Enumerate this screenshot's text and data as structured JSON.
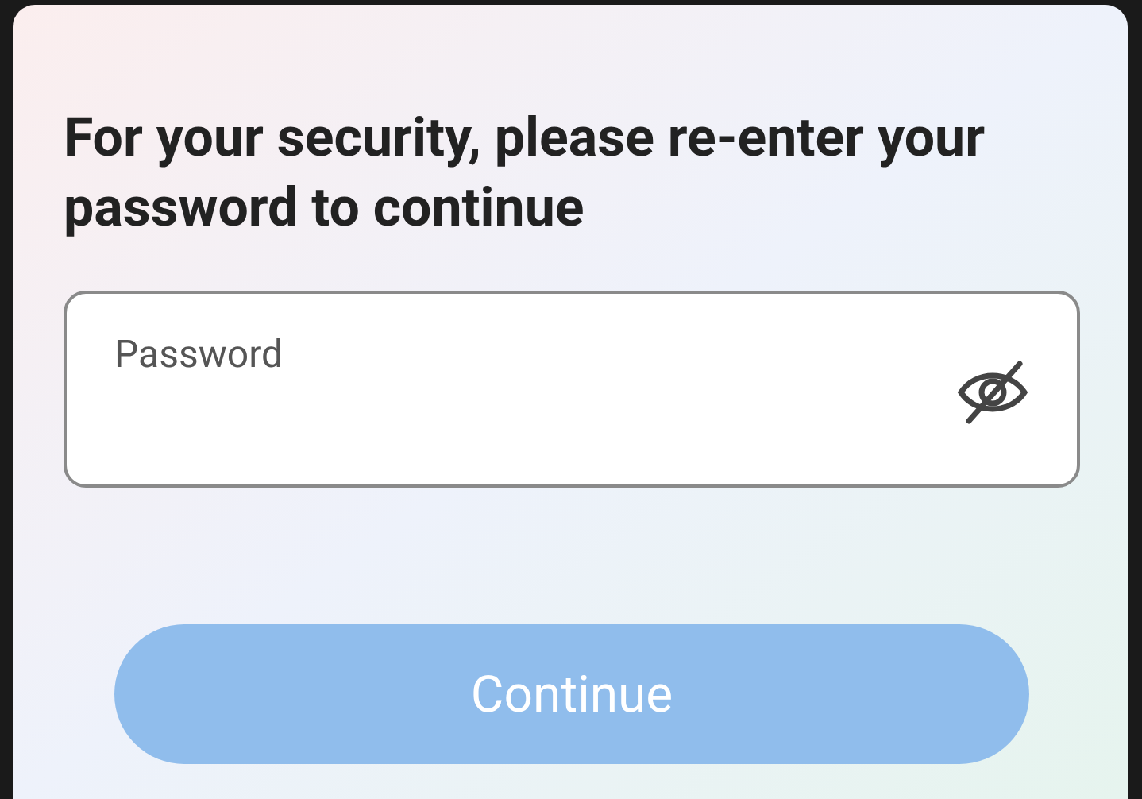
{
  "heading": "For your security, please re-enter your password to continue",
  "password_field": {
    "label": "Password",
    "visible": false
  },
  "continue_button": {
    "label": "Continue",
    "disabled": true
  }
}
